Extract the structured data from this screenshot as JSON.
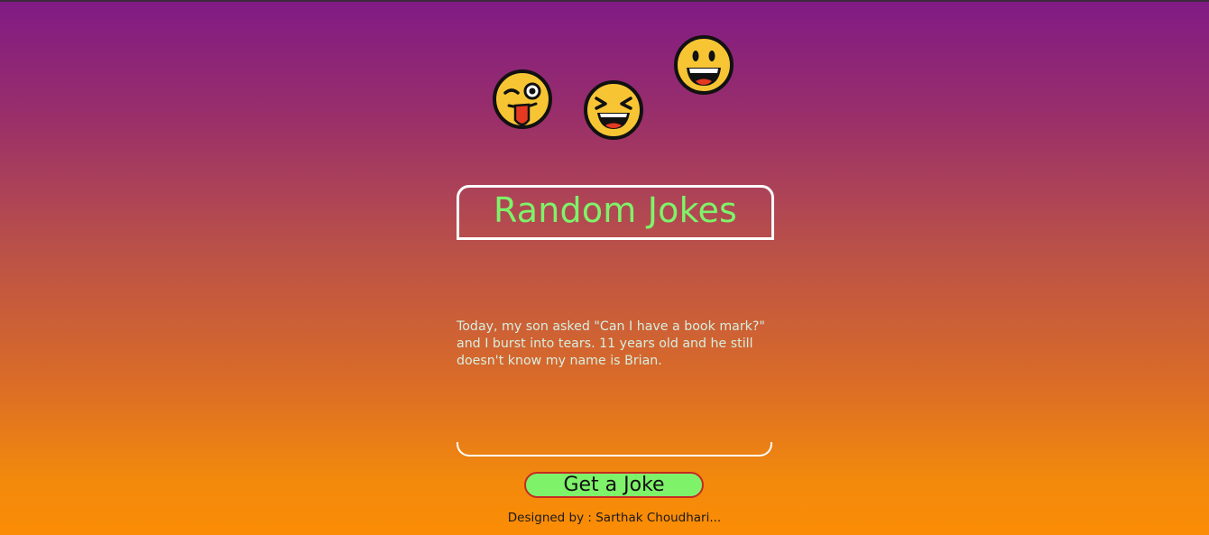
{
  "title": "Random Jokes",
  "joke": {
    "text": "Today, my son asked \"Can I have a book mark?\" and I burst into tears. 11 years old and he still doesn't know my name is Brian."
  },
  "button": {
    "label": "Get a Joke"
  },
  "footer": {
    "text": "Designed by : Sarthak Choudhari..."
  },
  "icons": [
    "winking-tongue-face-icon",
    "laughing-squint-face-icon",
    "grinning-face-icon"
  ],
  "colors": {
    "title": "#7ef36a",
    "button_bg": "#7ef36a",
    "button_border": "#c62a22",
    "joke_text": "#d6efe0",
    "gradient_top": "#801a85",
    "gradient_bottom": "#fb8c05"
  }
}
